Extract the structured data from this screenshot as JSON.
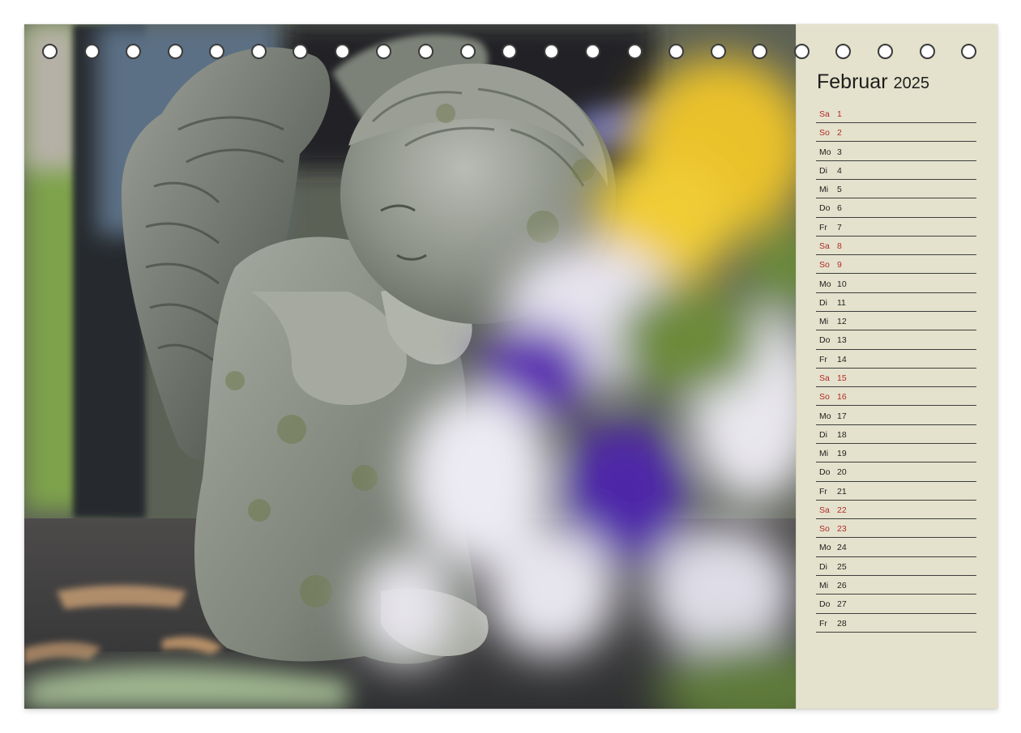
{
  "calendar": {
    "month": "Februar",
    "year": "2025",
    "days": [
      {
        "weekday": "Sa",
        "day": "1",
        "weekend": true
      },
      {
        "weekday": "So",
        "day": "2",
        "weekend": true
      },
      {
        "weekday": "Mo",
        "day": "3",
        "weekend": false
      },
      {
        "weekday": "Di",
        "day": "4",
        "weekend": false
      },
      {
        "weekday": "Mi",
        "day": "5",
        "weekend": false
      },
      {
        "weekday": "Do",
        "day": "6",
        "weekend": false
      },
      {
        "weekday": "Fr",
        "day": "7",
        "weekend": false
      },
      {
        "weekday": "Sa",
        "day": "8",
        "weekend": true
      },
      {
        "weekday": "So",
        "day": "9",
        "weekend": true
      },
      {
        "weekday": "Mo",
        "day": "10",
        "weekend": false
      },
      {
        "weekday": "Di",
        "day": "11",
        "weekend": false
      },
      {
        "weekday": "Mi",
        "day": "12",
        "weekend": false
      },
      {
        "weekday": "Do",
        "day": "13",
        "weekend": false
      },
      {
        "weekday": "Fr",
        "day": "14",
        "weekend": false
      },
      {
        "weekday": "Sa",
        "day": "15",
        "weekend": true
      },
      {
        "weekday": "So",
        "day": "16",
        "weekend": true
      },
      {
        "weekday": "Mo",
        "day": "17",
        "weekend": false
      },
      {
        "weekday": "Di",
        "day": "18",
        "weekend": false
      },
      {
        "weekday": "Mi",
        "day": "19",
        "weekend": false
      },
      {
        "weekday": "Do",
        "day": "20",
        "weekend": false
      },
      {
        "weekday": "Fr",
        "day": "21",
        "weekend": false
      },
      {
        "weekday": "Sa",
        "day": "22",
        "weekend": true
      },
      {
        "weekday": "So",
        "day": "23",
        "weekend": true
      },
      {
        "weekday": "Mo",
        "day": "24",
        "weekend": false
      },
      {
        "weekday": "Di",
        "day": "25",
        "weekend": false
      },
      {
        "weekday": "Mi",
        "day": "26",
        "weekend": false
      },
      {
        "weekday": "Do",
        "day": "27",
        "weekend": false
      },
      {
        "weekday": "Fr",
        "day": "28",
        "weekend": false
      }
    ]
  },
  "binding": {
    "hole_count": 23
  },
  "colors": {
    "panel_background": "#e4e2cc",
    "weekend_text": "#b12a2a",
    "weekday_text": "#1e1e1e",
    "rule_line": "#3e3e3e"
  }
}
